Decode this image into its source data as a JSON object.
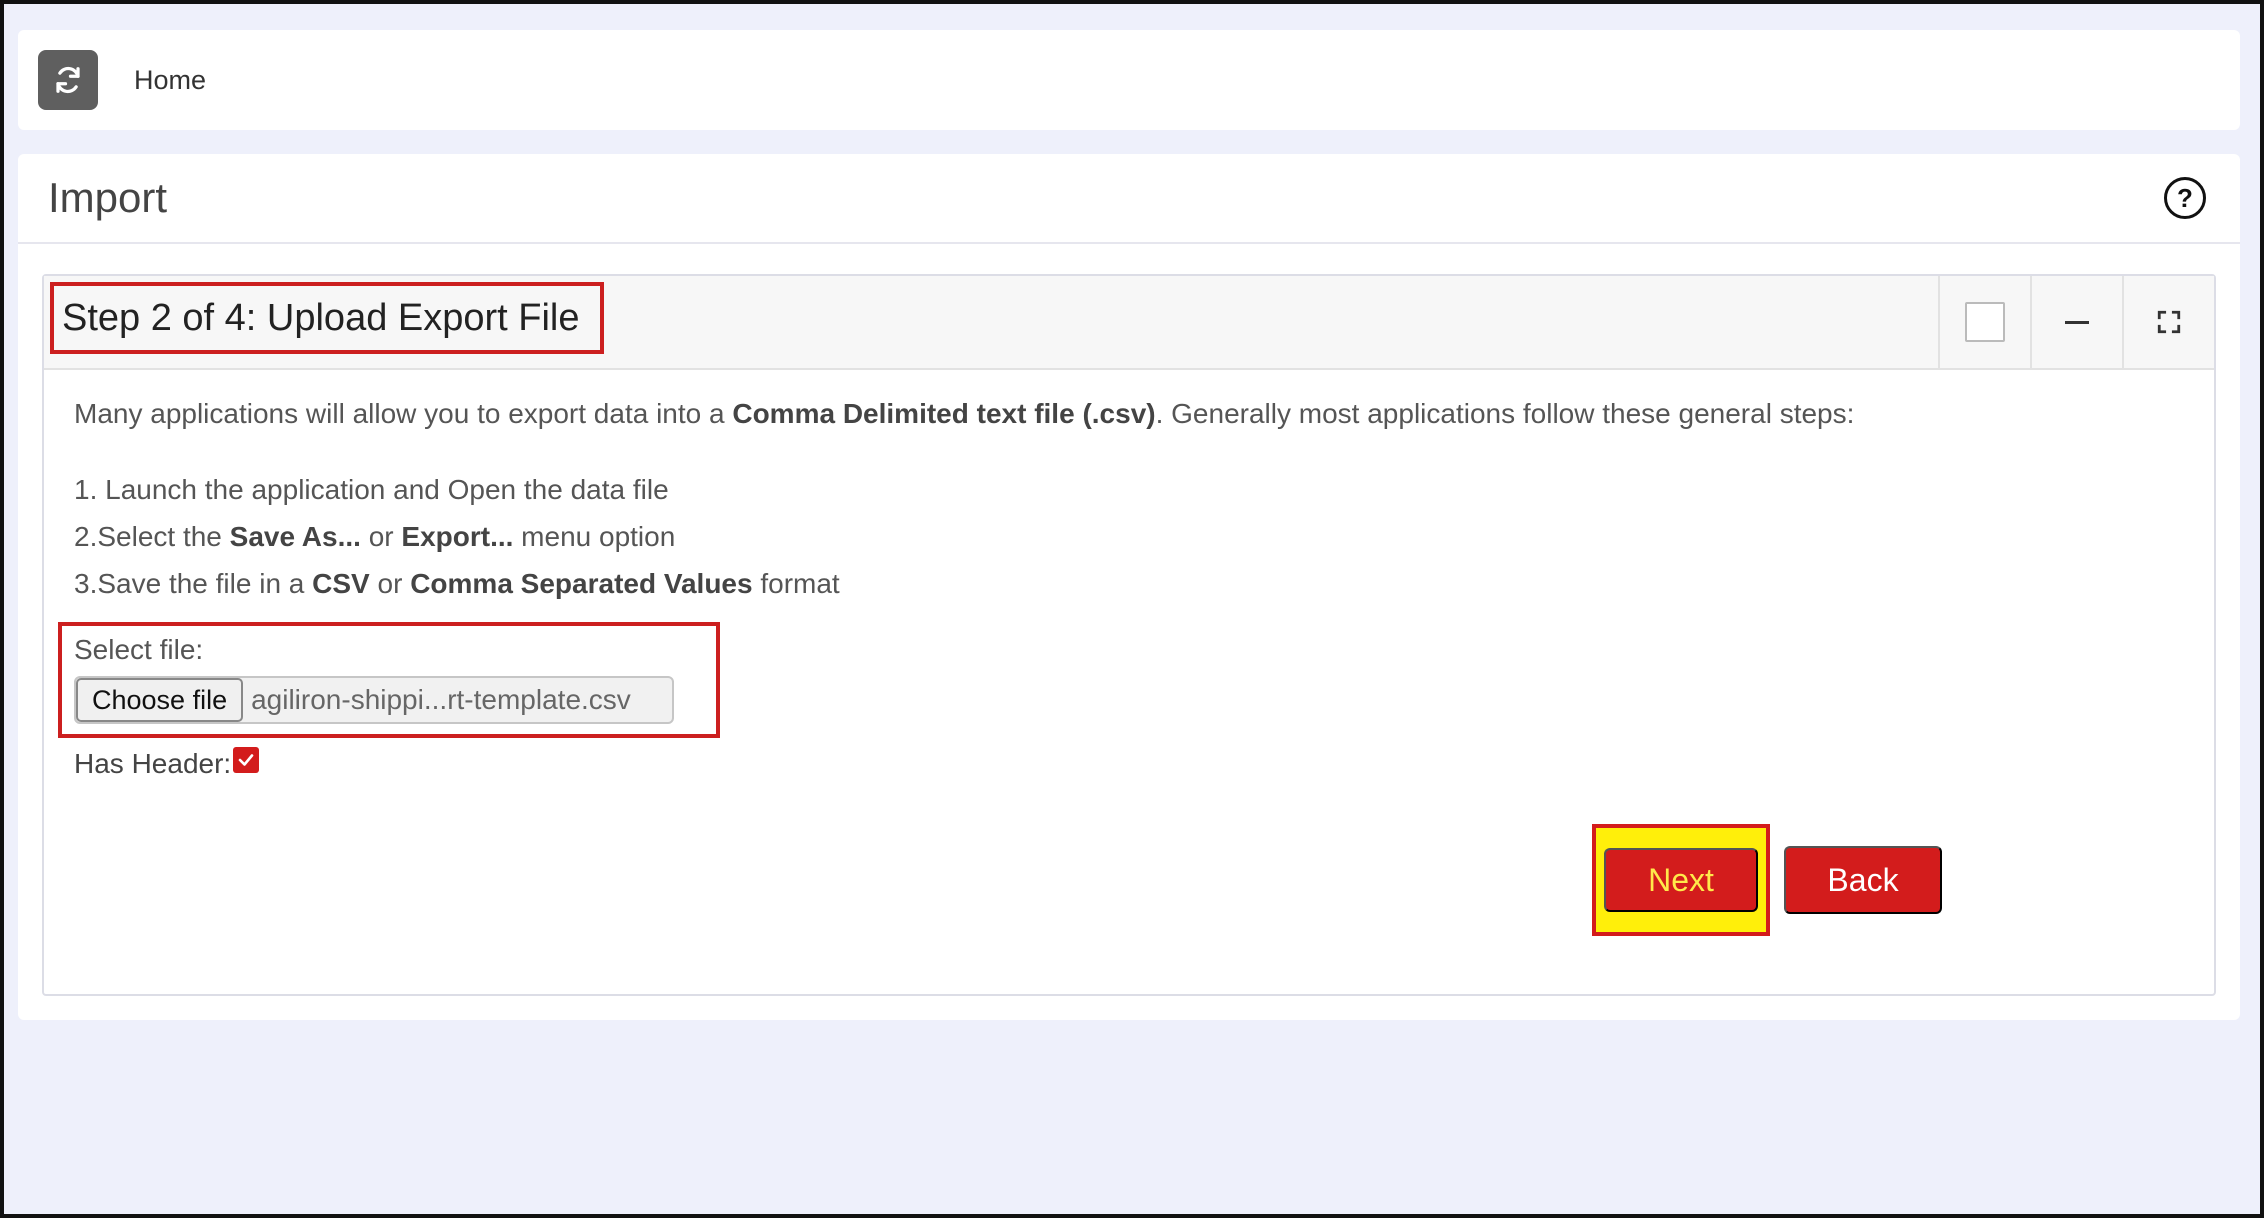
{
  "topbar": {
    "refresh_icon": "refresh-icon",
    "home_label": "Home"
  },
  "page": {
    "title": "Import",
    "help_icon": "question-circle-icon"
  },
  "card": {
    "title": "Step 2 of 4: Upload Export File",
    "tools": [
      "checkbox",
      "minimize-icon",
      "expand-icon"
    ]
  },
  "intro": {
    "prefix": "Many applications will allow you to export data into a ",
    "bold": "Comma Delimited text file (.csv)",
    "suffix": ". Generally most applications follow these general steps:"
  },
  "steps": {
    "step1": "1. Launch the application and Open the data file",
    "step2_prefix": "2.Select the ",
    "step2_bold1": "Save As...",
    "step2_mid": " or ",
    "step2_bold2": "Export...",
    "step2_suffix": " menu option",
    "step3_prefix": "3.Save the file in a ",
    "step3_bold1": "CSV",
    "step3_mid": " or ",
    "step3_bold2": "Comma Separated Values",
    "step3_suffix": " format"
  },
  "file": {
    "label": "Select file:",
    "button": "Choose file",
    "filename": "agiliron-shippi...rt-template.csv"
  },
  "has_header": {
    "label": "Has Header:",
    "checked": true
  },
  "actions": {
    "next": "Next",
    "back": "Back"
  },
  "colors": {
    "accent_red": "#d31c1c",
    "highlight_yellow": "#ffef0a",
    "background": "#eef0fb"
  }
}
